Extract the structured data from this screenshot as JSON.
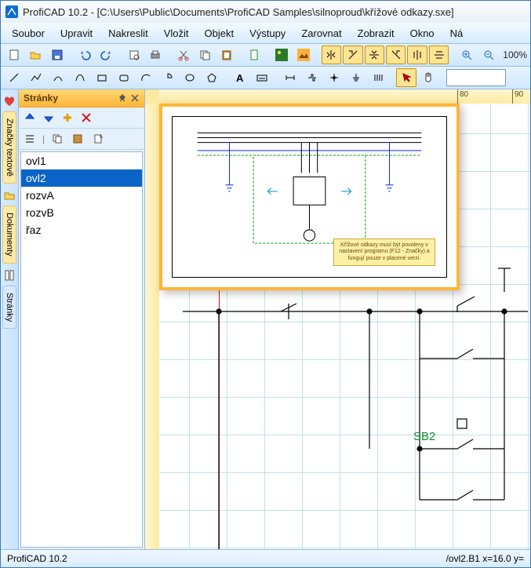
{
  "title": "ProfiCAD 10.2 - [C:\\Users\\Public\\Documents\\ProfiCAD Samples\\silnoproud\\křížové odkazy.sxe]",
  "menu": [
    "Soubor",
    "Upravit",
    "Nakreslit",
    "Vložit",
    "Objekt",
    "Výstupy",
    "Zarovnat",
    "Zobrazit",
    "Okno",
    "Ná"
  ],
  "zoom": "100%",
  "panel": {
    "title": "Stránky",
    "items": [
      "ovl1",
      "ovl2",
      "rozvA",
      "rozvB",
      "řaz"
    ],
    "selected": 1
  },
  "vtabs": [
    "Značky textově",
    "Dokumenty",
    "Stránky"
  ],
  "ruler": {
    "ticks": [
      {
        "pos": 380,
        "label": "80"
      },
      {
        "pos": 450,
        "label": "90"
      }
    ]
  },
  "canvas": {
    "label_sb2": "SB2"
  },
  "preview_note": "Křížové odkazy musí být povoleny v nastavení programu (F12 - Značky) a fungují pouze v placené verzi.",
  "status": {
    "left": "ProfiCAD 10.2",
    "right": "/ovl2.B1  x=16.0  y="
  }
}
